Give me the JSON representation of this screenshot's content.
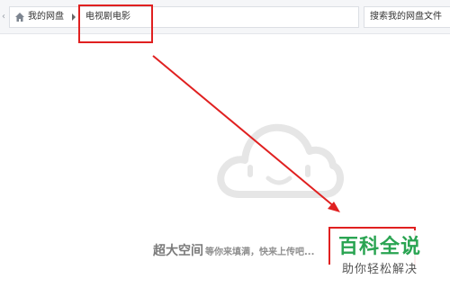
{
  "breadcrumb": {
    "root_label": "我的网盘",
    "current_label": "电视剧电影"
  },
  "search": {
    "placeholder": "搜索我的网盘文件"
  },
  "empty_state": {
    "title": "超大空间",
    "subtitle": "等你来填满，快来上传吧..."
  },
  "watermark": {
    "title": "百科全说",
    "subtitle": "助你轻松解决"
  },
  "colors": {
    "annotation": "#e02020",
    "watermark_green": "#2aa452",
    "cloud_gray": "#e6e6e6"
  },
  "icons": {
    "home": "home-icon",
    "separator": "chevron-right-icon",
    "back": "chevron-left-icon",
    "empty": "cloud-smile-icon"
  }
}
